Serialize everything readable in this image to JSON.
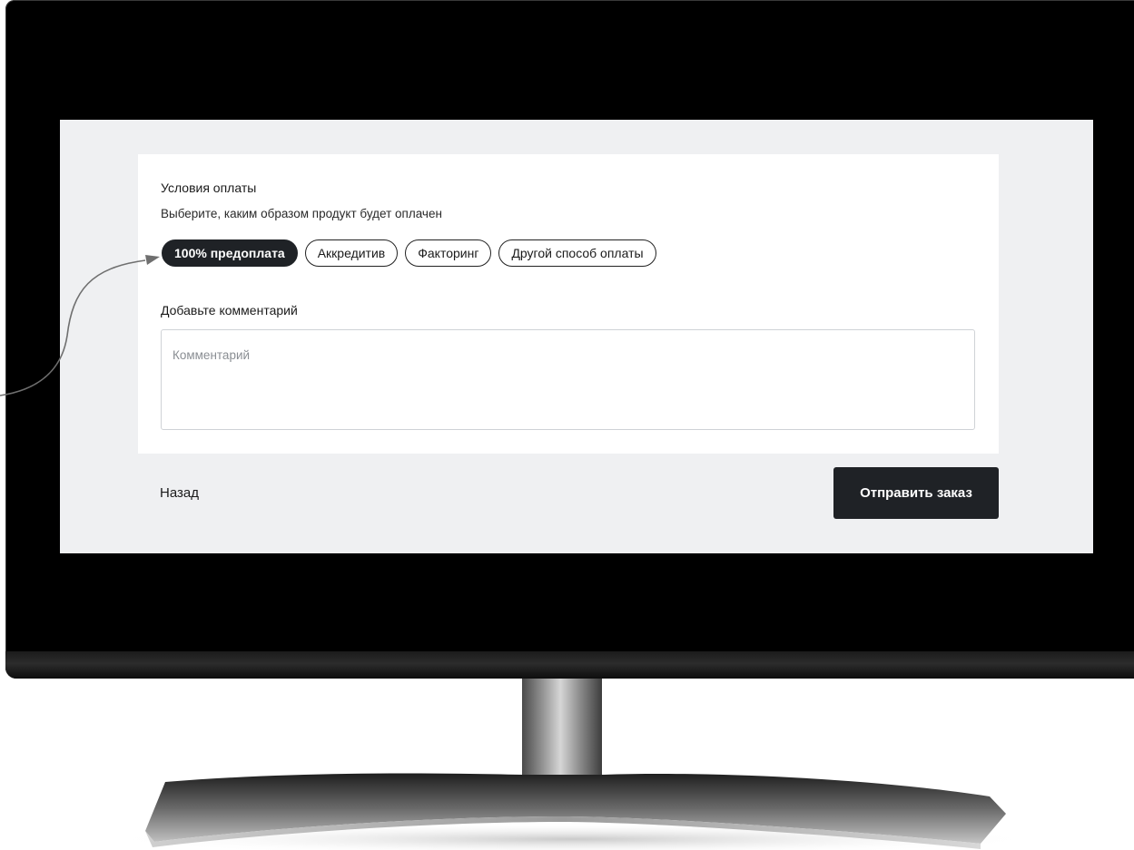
{
  "payment": {
    "title": "Условия оплаты",
    "subtitle": "Выберите, каким образом продукт будет оплачен",
    "options": [
      {
        "label": "100% предоплата",
        "selected": true
      },
      {
        "label": "Аккредитив",
        "selected": false
      },
      {
        "label": "Факторинг",
        "selected": false
      },
      {
        "label": "Другой способ оплаты",
        "selected": false
      }
    ]
  },
  "comment": {
    "title": "Добавьте комментарий",
    "placeholder": "Комментарий",
    "value": ""
  },
  "footer": {
    "back_label": "Назад",
    "submit_label": "Отправить заказ"
  },
  "colors": {
    "screen_background": "#eff0f2",
    "card_background": "#ffffff",
    "primary_dark": "#1f2226",
    "monitor_frame": "#000000"
  },
  "icons": {
    "annotation": "curved-arrow-icon"
  }
}
